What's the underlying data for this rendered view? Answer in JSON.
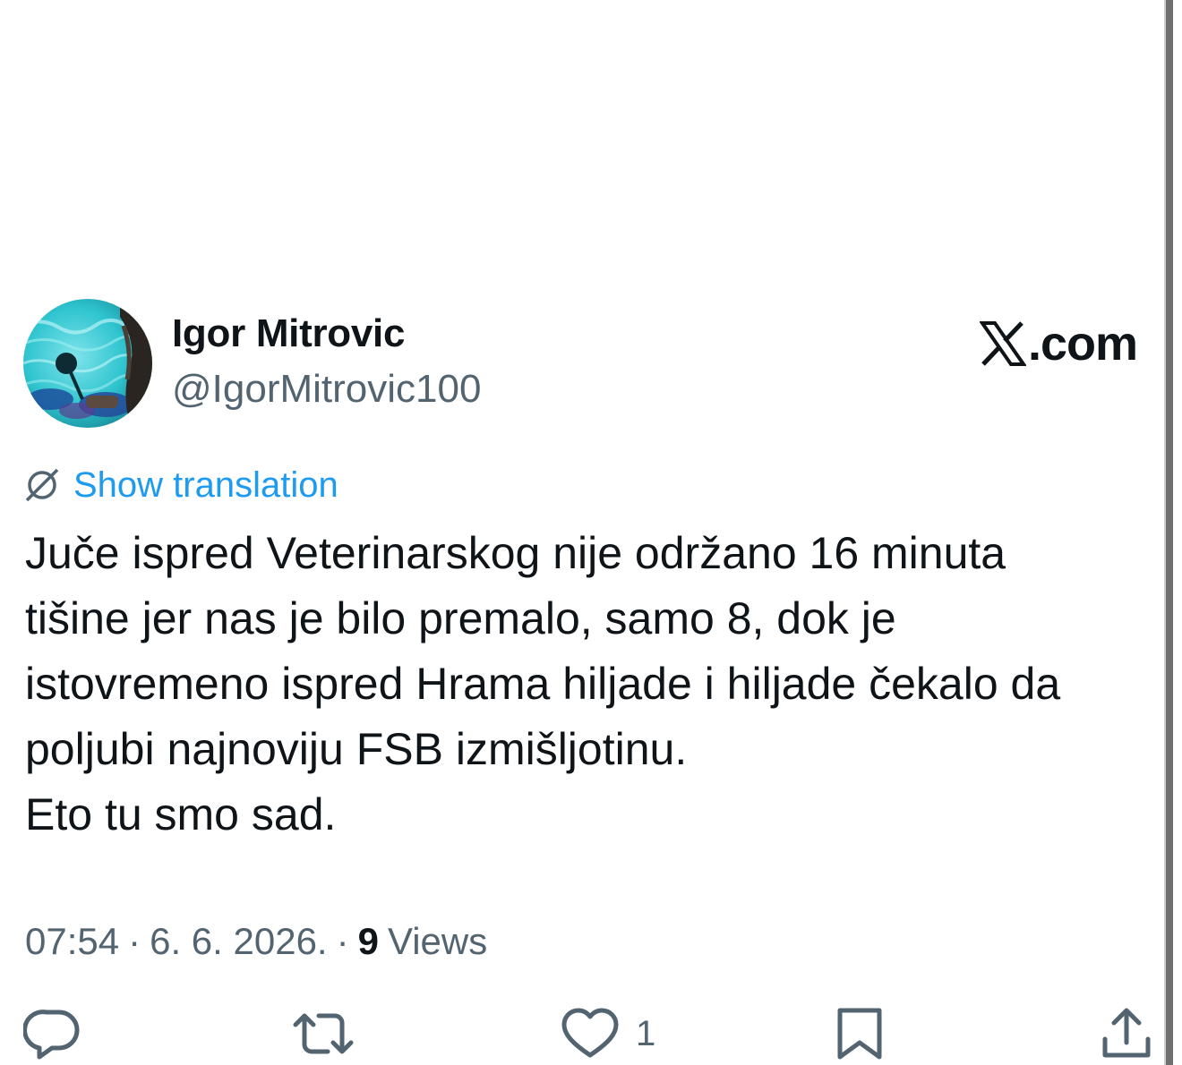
{
  "author": {
    "display_name": "Igor Mitrovic",
    "handle": "@IgorMitrovic100",
    "avatar_icon": "avatar-image"
  },
  "brand": {
    "text": ".com",
    "icon": "x-logo-icon"
  },
  "translation": {
    "label": "Show translation",
    "icon": "globe-translate-icon",
    "color": "#1d9bf0"
  },
  "tweet": {
    "lines": [
      "Juče ispred Veterinarskog nije održano 16 minuta",
      "tišine jer nas je bilo premalo, samo 8, dok je",
      "istovremeno ispred Hrama hiljade i hiljade čekalo da",
      "poljubi najnoviju FSB izmišljotinu.",
      "Eto tu smo sad."
    ]
  },
  "meta": {
    "time": "07:54",
    "separator": "·",
    "date": "6. 6. 2026.",
    "views_count": "9",
    "views_label": "Views"
  },
  "actions": {
    "reply": {
      "icon": "reply-icon",
      "count": ""
    },
    "repost": {
      "icon": "repost-icon",
      "count": ""
    },
    "like": {
      "icon": "heart-icon",
      "count": "1"
    },
    "bookmark": {
      "icon": "bookmark-icon",
      "count": ""
    },
    "share": {
      "icon": "share-icon",
      "count": ""
    }
  },
  "colors": {
    "text_primary": "#0f1419",
    "text_secondary": "#536471",
    "accent": "#1d9bf0",
    "background": "#ffffff"
  }
}
